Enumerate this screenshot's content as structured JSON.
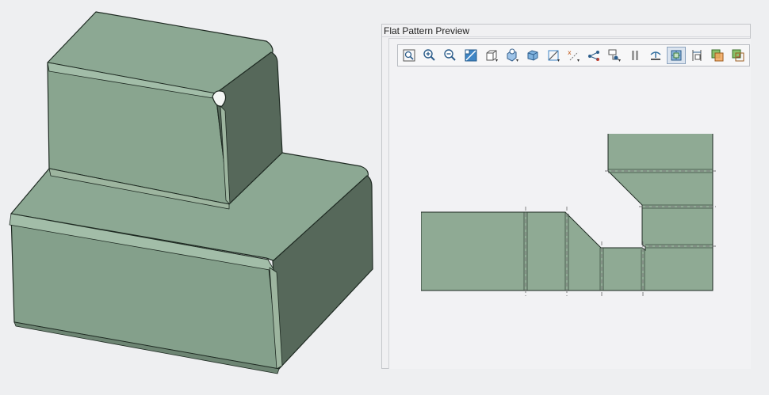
{
  "window": {
    "title": "Flat Pattern Preview"
  },
  "colors": {
    "sheet_metal_fill": "#8faa94",
    "sheet_metal_top": "#8ca893",
    "sheet_metal_right_side": "#56685a",
    "sheet_metal_front": "#84a08b",
    "edge": "#1e2a22",
    "bend_line": "#777777",
    "viewport_background": "#eeeff1"
  },
  "toolbar": {
    "buttons": [
      {
        "icon": "zoom-window-icon",
        "active": false
      },
      {
        "icon": "zoom-in-icon",
        "active": false
      },
      {
        "icon": "zoom-out-icon",
        "active": false
      },
      {
        "icon": "refit-icon",
        "active": false
      },
      {
        "icon": "display-style-icon",
        "active": false
      },
      {
        "icon": "saved-orientations-icon",
        "active": false
      },
      {
        "icon": "view-manager-icon",
        "active": false
      },
      {
        "icon": "datum-display-icon",
        "active": false
      },
      {
        "icon": "annotation-display-icon",
        "active": false
      },
      {
        "icon": "bend-lines-icon",
        "active": false
      },
      {
        "icon": "measure-icon",
        "active": false
      },
      {
        "icon": "pause-icon",
        "active": false
      },
      {
        "icon": "spin-center-icon",
        "active": false
      },
      {
        "icon": "show-flat-pattern-icon",
        "active": true
      },
      {
        "icon": "dimension-icon",
        "active": false
      },
      {
        "icon": "overlay-icon",
        "active": false
      },
      {
        "icon": "compare-icon",
        "active": false
      }
    ]
  }
}
